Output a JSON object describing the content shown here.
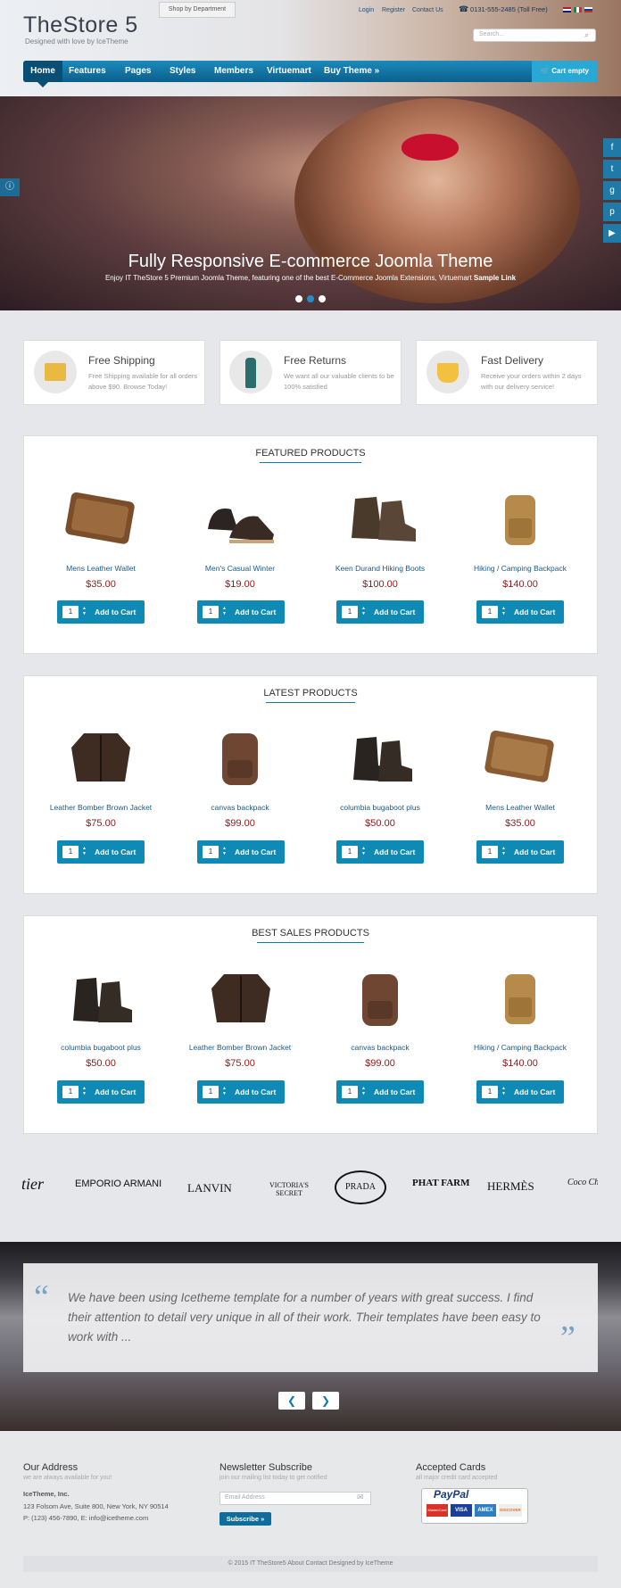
{
  "header": {
    "logo": "TheStore 5",
    "tagline": "Designed with love by IceTheme",
    "shop_by_department": "Shop by Department",
    "login": "Login",
    "register": "Register",
    "contact": "Contact Us",
    "phone": "0131-555-2485 (Toll Free)",
    "search_placeholder": "Search...",
    "nav": [
      "Home",
      "Features",
      "Pages",
      "Styles",
      "Members",
      "Virtuemart",
      "Buy Theme »"
    ],
    "cart": "Cart empty"
  },
  "hero": {
    "title": "Fully Responsive E-commerce Joomla Theme",
    "subtitle": "Enjoy IT TheStore 5 Premium Joomla Theme, featuring one of the best E-Commerce Joomla Extensions, Virtuemart",
    "link": "Sample Link"
  },
  "features": [
    {
      "title": "Free Shipping",
      "desc": "Free Shipping available for all orders above $90. Browse Today!"
    },
    {
      "title": "Free Returns",
      "desc": "We want all our valuable clients to be 100% satisfied"
    },
    {
      "title": "Fast Delivery",
      "desc": "Receive your orders within 2 days with our delivery service!"
    }
  ],
  "add_to_cart": "Add to Cart",
  "sections": [
    {
      "title": "FEATURED PRODUCTS",
      "products": [
        {
          "name": "Mens Leather Wallet",
          "price": "$35.00",
          "qty": "1"
        },
        {
          "name": "Men's Casual Winter",
          "price": "$19.00",
          "qty": "1"
        },
        {
          "name": "Keen Durand Hiking Boots",
          "price": "$100.00",
          "qty": "1"
        },
        {
          "name": "Hiking / Camping Backpack",
          "price": "$140.00",
          "qty": "1"
        }
      ]
    },
    {
      "title": "LATEST PRODUCTS",
      "products": [
        {
          "name": "Leather Bomber Brown Jacket",
          "price": "$75.00",
          "qty": "1"
        },
        {
          "name": "canvas backpack",
          "price": "$99.00",
          "qty": "1"
        },
        {
          "name": "columbia bugaboot plus",
          "price": "$50.00",
          "qty": "1"
        },
        {
          "name": "Mens Leather Wallet",
          "price": "$35.00",
          "qty": "1"
        }
      ]
    },
    {
      "title": "BEST SALES PRODUCTS",
      "products": [
        {
          "name": "columbia bugaboot plus",
          "price": "$50.00",
          "qty": "1"
        },
        {
          "name": "Leather Bomber Brown Jacket",
          "price": "$75.00",
          "qty": "1"
        },
        {
          "name": "canvas backpack",
          "price": "$99.00",
          "qty": "1"
        },
        {
          "name": "Hiking / Camping Backpack",
          "price": "$140.00",
          "qty": "1"
        }
      ]
    }
  ],
  "brands": [
    "tier",
    "EMPORIO ARMANI",
    "LANVIN",
    "VICTORIA'S SECRET",
    "PRADA",
    "PHAT FARM",
    "HERMÈS",
    "Coco Chanel"
  ],
  "testimonial": {
    "quote": "We have been using Icetheme template for a number of years with great success. I find their attention to detail very unique in all of their work. Their templates have been easy to work with ..."
  },
  "footer": {
    "address_title": "Our Address",
    "address_sub": "we are always available for you!",
    "company": "IceTheme, Inc.",
    "address": "123 Folsom Ave, Suite 800, New York, NY 90514",
    "contact_line": "P: (123) 456-7890, E: info@icetheme.com",
    "newsletter_title": "Newsletter Subscribe",
    "newsletter_sub": "join our mailing list today to get notified",
    "email_placeholder": "Email Address",
    "subscribe": "Subscribe »",
    "cards_title": "Accepted Cards",
    "cards_sub": "all major credit card accepted",
    "paypal": "PayPal",
    "card_names": [
      "MasterCard",
      "VISA",
      "AMEX",
      "DISCOVER"
    ],
    "copyright": "© 2015 IT TheStore5   About   Contact   Designed by IceTheme"
  }
}
